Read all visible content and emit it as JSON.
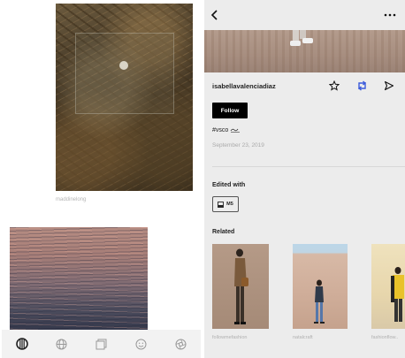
{
  "left_panel": {
    "photo_caption": "maddinelong",
    "tab_icons": [
      "vsco-lens-icon",
      "globe-icon",
      "gallery-icon",
      "smiley-icon",
      "aperture-icon"
    ]
  },
  "right_panel": {
    "username": "isabellavalenciadiaz",
    "follow_label": "Follow",
    "tagline": "#vsco",
    "date": "September 23, 2019",
    "edited_with_label": "Edited with",
    "preset_label": "M5",
    "related_label": "Related",
    "related": [
      {
        "caption": "followmefashion"
      },
      {
        "caption": "natalcraft"
      },
      {
        "caption": "fashionflow.."
      }
    ]
  },
  "colors": {
    "accent_blue": "#3b5bdb",
    "follow_bg": "#000000",
    "right_bg": "#ececec"
  }
}
